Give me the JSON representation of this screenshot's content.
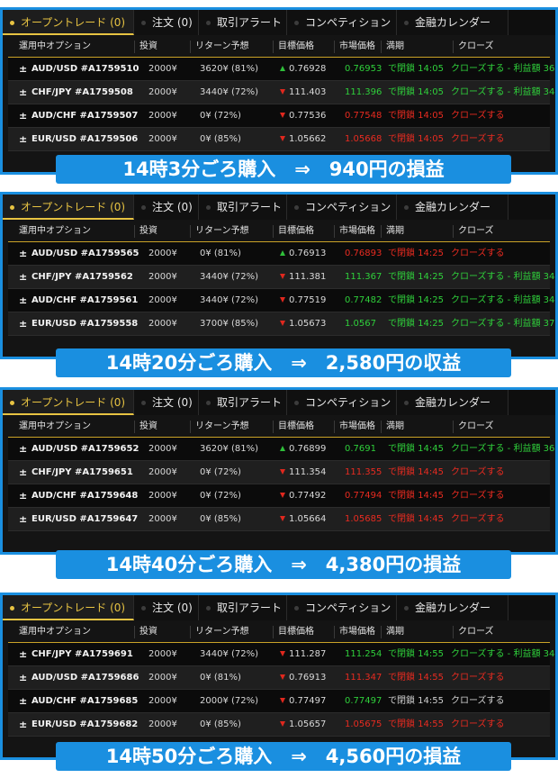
{
  "tabs": [
    "オープントレード (0)",
    "注文 (0)",
    "取引アラート",
    "コンペティション",
    "金融カレンダー"
  ],
  "headers": [
    "運用中オプション",
    "投資",
    "リターン予想",
    "目標価格",
    "市場価格",
    "満期",
    "クローズ"
  ],
  "panels": [
    {
      "banner": "14時3分ごろ購入　⇒　940円の損益",
      "rows": [
        {
          "option": "AUD/USD #A1759510",
          "invest": "2000¥",
          "ret": "3620¥ (81%)",
          "dir": "up",
          "target": "0.76928",
          "market": "0.76953",
          "market_color": "up",
          "expiry": "で閉鎖 14:05",
          "close": "クローズする - 利益額 3620¥",
          "close_color": "up"
        },
        {
          "option": "CHF/JPY #A1759508",
          "invest": "2000¥",
          "ret": "3440¥ (72%)",
          "dir": "down",
          "target": "111.403",
          "market": "111.396",
          "market_color": "up",
          "expiry": "で閉鎖 14:05",
          "close": "クローズする - 利益額 3440¥",
          "close_color": "up"
        },
        {
          "option": "AUD/CHF #A1759507",
          "invest": "2000¥",
          "ret": "0¥ (72%)",
          "dir": "down",
          "target": "0.77536",
          "market": "0.77548",
          "market_color": "down",
          "expiry": "で閉鎖 14:05",
          "close": "クローズする",
          "close_color": "down"
        },
        {
          "option": "EUR/USD #A1759506",
          "invest": "2000¥",
          "ret": "0¥ (85%)",
          "dir": "down",
          "target": "1.05662",
          "market": "1.05668",
          "market_color": "down",
          "expiry": "で閉鎖 14:05",
          "close": "クローズする",
          "close_color": "down"
        }
      ]
    },
    {
      "banner": "14時20分ごろ購入　⇒　2,580円の収益",
      "rows": [
        {
          "option": "AUD/USD #A1759565",
          "invest": "2000¥",
          "ret": "0¥ (81%)",
          "dir": "up",
          "target": "0.76913",
          "market": "0.76893",
          "market_color": "down",
          "expiry": "で閉鎖 14:25",
          "close": "クローズする",
          "close_color": "down"
        },
        {
          "option": "CHF/JPY #A1759562",
          "invest": "2000¥",
          "ret": "3440¥ (72%)",
          "dir": "down",
          "target": "111.381",
          "market": "111.367",
          "market_color": "up",
          "expiry": "で閉鎖 14:25",
          "close": "クローズする - 利益額 3440¥",
          "close_color": "up"
        },
        {
          "option": "AUD/CHF #A1759561",
          "invest": "2000¥",
          "ret": "3440¥ (72%)",
          "dir": "down",
          "target": "0.77519",
          "market": "0.77482",
          "market_color": "up",
          "expiry": "で閉鎖 14:25",
          "close": "クローズする - 利益額 3440¥",
          "close_color": "up"
        },
        {
          "option": "EUR/USD #A1759558",
          "invest": "2000¥",
          "ret": "3700¥ (85%)",
          "dir": "down",
          "target": "1.05673",
          "market": "1.0567",
          "market_color": "up",
          "expiry": "で閉鎖 14:25",
          "close": "クローズする - 利益額 3700¥",
          "close_color": "up"
        }
      ]
    },
    {
      "banner": "14時40分ごろ購入　⇒　4,380円の損益",
      "rows": [
        {
          "option": "AUD/USD #A1759652",
          "invest": "2000¥",
          "ret": "3620¥ (81%)",
          "dir": "up",
          "target": "0.76899",
          "market": "0.7691",
          "market_color": "up",
          "expiry": "で閉鎖 14:45",
          "close": "クローズする - 利益額 3620¥",
          "close_color": "up"
        },
        {
          "option": "CHF/JPY #A1759651",
          "invest": "2000¥",
          "ret": "0¥ (72%)",
          "dir": "down",
          "target": "111.354",
          "market": "111.355",
          "market_color": "down",
          "expiry": "で閉鎖 14:45",
          "close": "クローズする",
          "close_color": "down"
        },
        {
          "option": "AUD/CHF #A1759648",
          "invest": "2000¥",
          "ret": "0¥ (72%)",
          "dir": "down",
          "target": "0.77492",
          "market": "0.77494",
          "market_color": "down",
          "expiry": "で閉鎖 14:45",
          "close": "クローズする",
          "close_color": "down"
        },
        {
          "option": "EUR/USD #A1759647",
          "invest": "2000¥",
          "ret": "0¥ (85%)",
          "dir": "down",
          "target": "1.05664",
          "market": "1.05685",
          "market_color": "down",
          "expiry": "で閉鎖 14:45",
          "close": "クローズする",
          "close_color": "down"
        }
      ]
    },
    {
      "banner": "14時50分ごろ購入　⇒　4,560円の損益",
      "rows": [
        {
          "option": "CHF/JPY #A1759691",
          "invest": "2000¥",
          "ret": "3440¥ (72%)",
          "dir": "down",
          "target": "111.287",
          "market": "111.254",
          "market_color": "up",
          "expiry": "で閉鎖 14:55",
          "close": "クローズする - 利益額 3440¥",
          "close_color": "up"
        },
        {
          "option": "AUD/USD #A1759686",
          "invest": "2000¥",
          "ret": "0¥ (81%)",
          "dir": "down",
          "target": "0.76913",
          "market": "111.347",
          "market_color": "down",
          "expiry": "で閉鎖 14:55",
          "close": "クローズする",
          "close_color": "down"
        },
        {
          "option": "AUD/CHF #A1759685",
          "invest": "2000¥",
          "ret": "2000¥ (72%)",
          "dir": "down",
          "target": "0.77497",
          "market": "0.77497",
          "market_color": "up",
          "expiry": "で閉鎖 14:55",
          "close": "クローズする",
          "close_color": "neutral"
        },
        {
          "option": "EUR/USD #A1759682",
          "invest": "2000¥",
          "ret": "0¥ (85%)",
          "dir": "down",
          "target": "1.05657",
          "market": "1.05675",
          "market_color": "down",
          "expiry": "で閉鎖 14:55",
          "close": "クローズする",
          "close_color": "down"
        }
      ]
    }
  ],
  "colors": {
    "accent": "#1a8fe0",
    "gold": "#e7c342",
    "up": "#2fcf3b",
    "down": "#e82b20"
  }
}
